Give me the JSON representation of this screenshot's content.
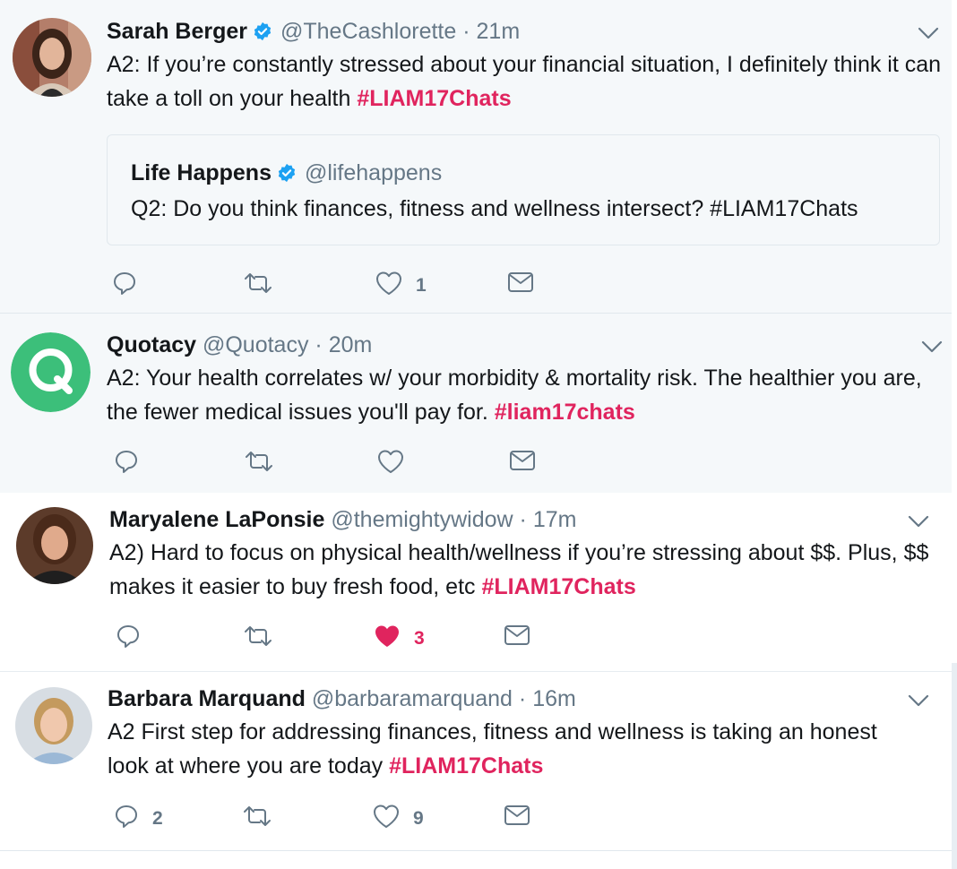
{
  "tweets": [
    {
      "name": "Sarah Berger",
      "verified": true,
      "handle": "@TheCashlorette",
      "time": "21m",
      "text_pre": "A2: If you’re constantly stressed about your financial situation, I definitely think it can take a toll on your health ",
      "hashtag": "#LIAM17Chats",
      "quote": {
        "name": "Life Happens",
        "verified": true,
        "handle": "@lifehappens",
        "text": "Q2: Do you think finances, fitness and wellness intersect? #LIAM17Chats"
      },
      "reply_count": "",
      "like_count": "1",
      "liked": false
    },
    {
      "name": "Quotacy",
      "verified": false,
      "handle": "@Quotacy",
      "time": "20m",
      "text_pre": "A2: Your health correlates w/ your morbidity & mortality risk. The healthier you are, the fewer medical issues you'll pay for. ",
      "hashtag": "#liam17chats",
      "reply_count": "",
      "like_count": "",
      "liked": false
    },
    {
      "name": "Maryalene LaPonsie",
      "verified": false,
      "handle": "@themightywidow",
      "time": "17m",
      "text_pre": "A2) Hard to focus on physical health/wellness if you’re stressing about $$. Plus, $$ makes it easier to buy fresh food, etc ",
      "hashtag": "#LIAM17Chats",
      "reply_count": "",
      "like_count": "3",
      "liked": true
    },
    {
      "name": "Barbara Marquand",
      "verified": false,
      "handle": "@barbaramarquand",
      "time": "16m",
      "text_pre": "A2 First step for addressing finances, fitness and wellness is taking an honest look at where you are today  ",
      "hashtag": "#LIAM17Chats",
      "reply_count": "2",
      "like_count": "9",
      "liked": false
    }
  ],
  "separator": "·",
  "colors": {
    "hashtag": "#e0245e",
    "like_active": "#e0245e",
    "verified": "#1da1f2",
    "muted": "#657786",
    "quotacy_brand": "#3cbf7a"
  },
  "icons": [
    "verified-badge-icon",
    "chevron-down-icon",
    "reply-icon",
    "retweet-icon",
    "like-icon",
    "direct-message-icon"
  ]
}
